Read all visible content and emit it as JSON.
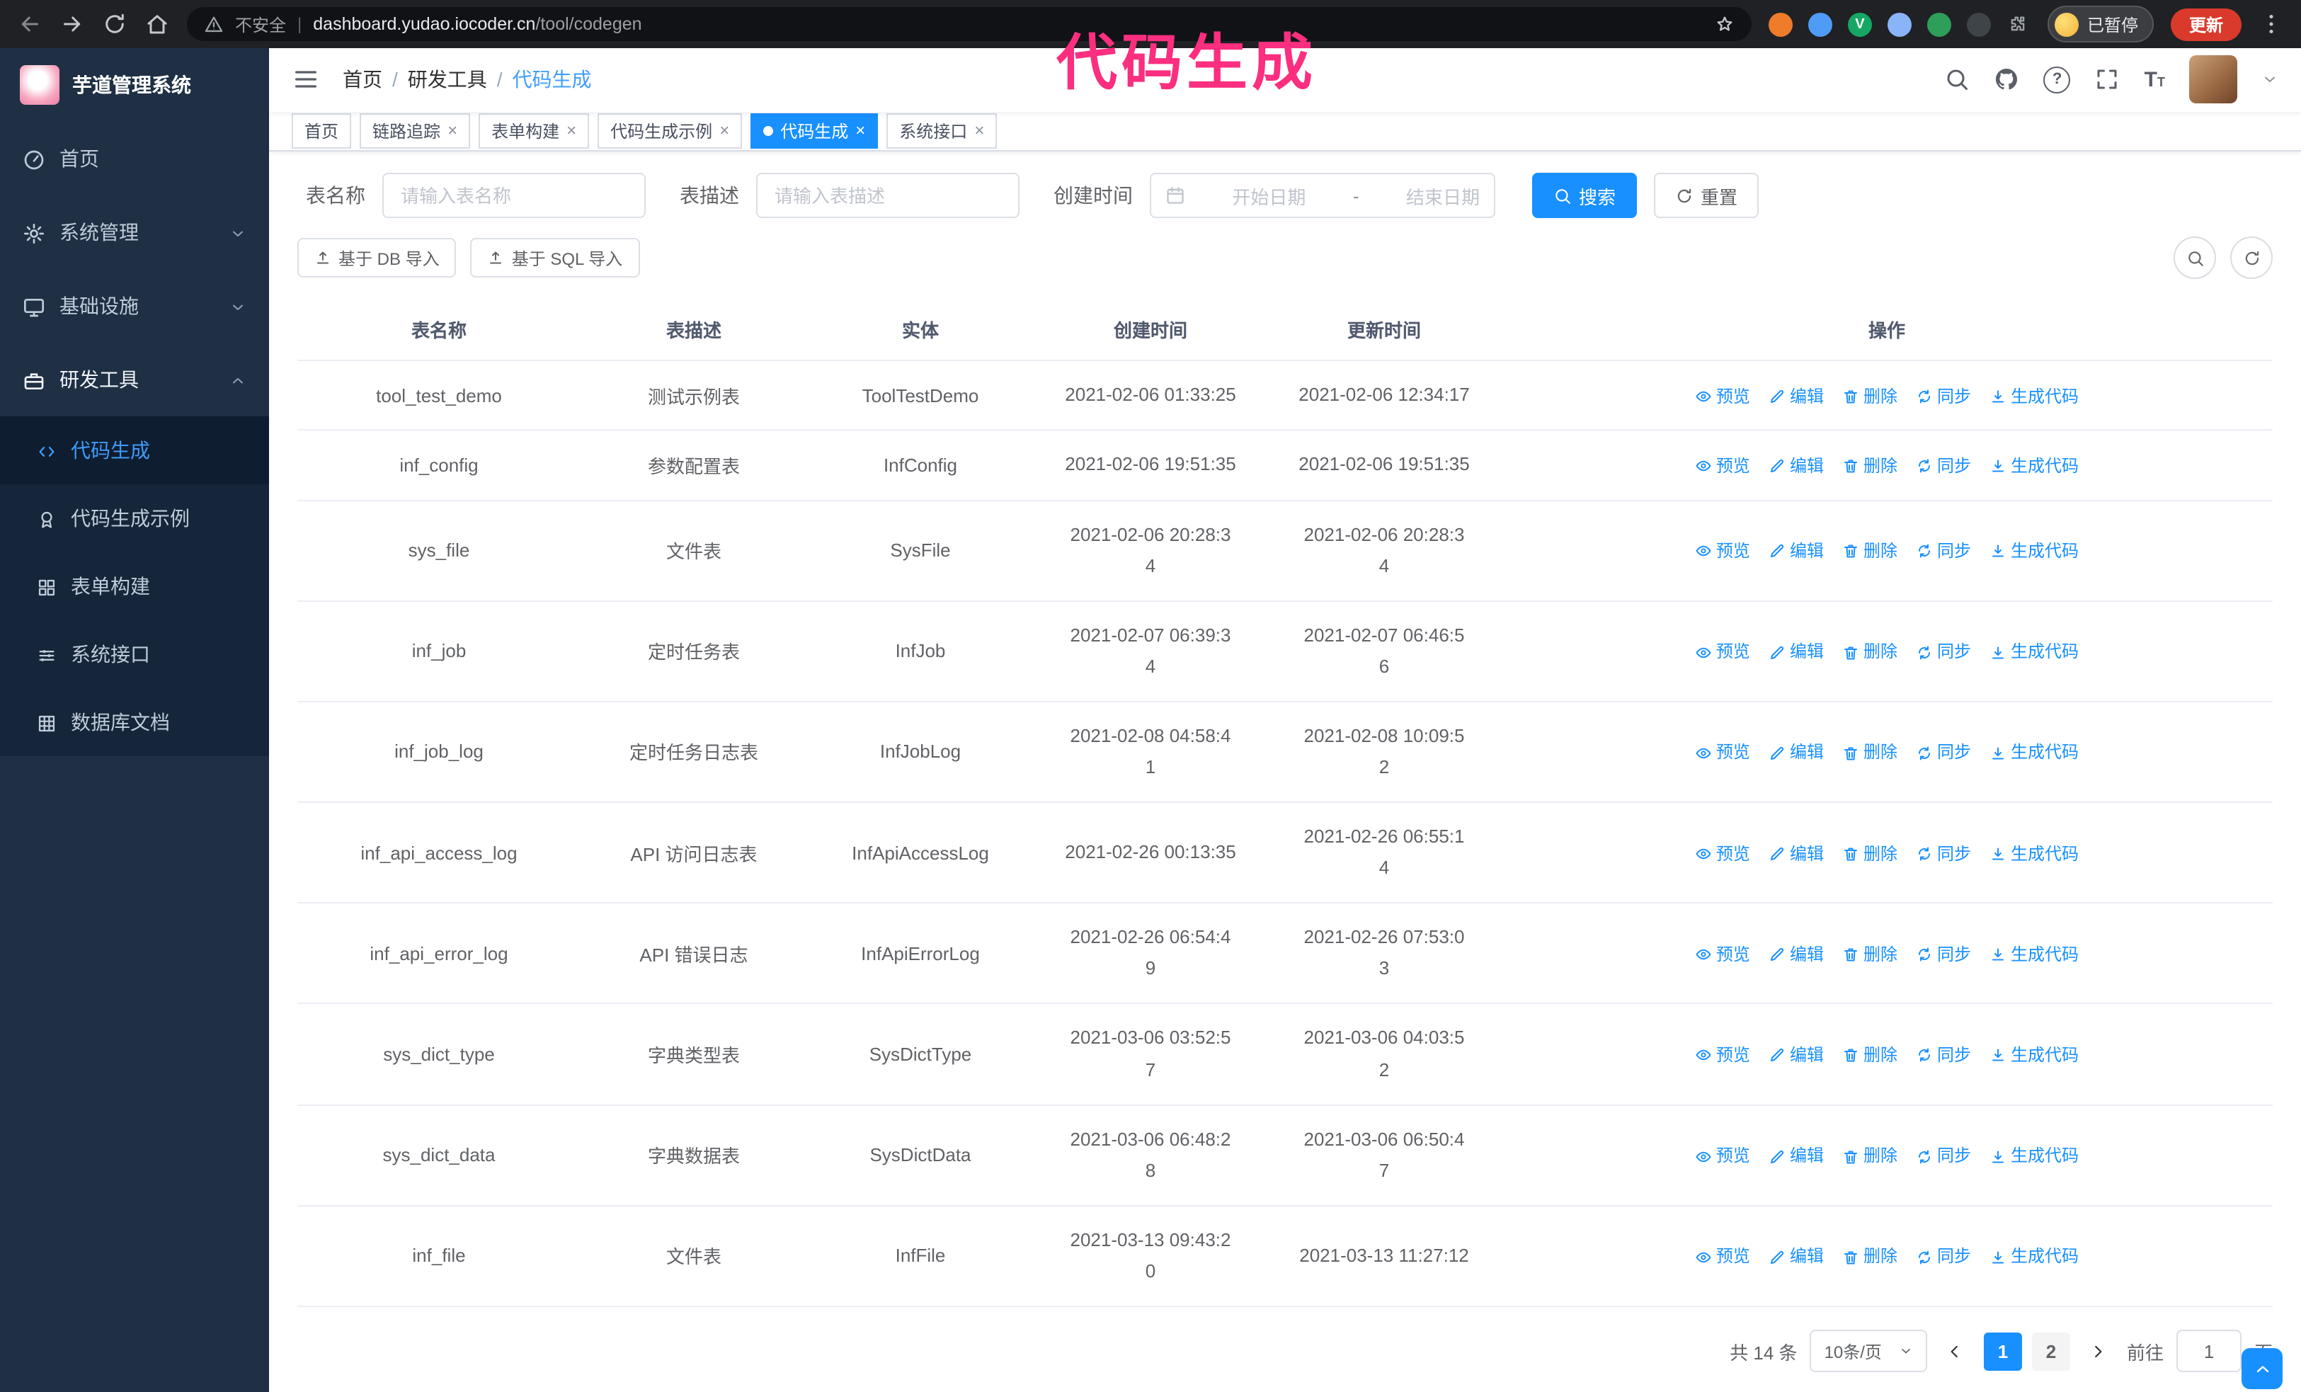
{
  "colors": {
    "accent": "#1890ff",
    "annotation": "#fb2e7f",
    "update_button": "#d93a2b",
    "sidebar_bg": "#1f3045",
    "active_link": "#3f9bfa"
  },
  "browser": {
    "security_label": "不安全",
    "url_domain": "dashboard.yudao.iocoder.cn",
    "url_path": "/tool/codegen",
    "profile_badge": "已暂停",
    "update_button": "更新",
    "extensions": [
      {
        "color": "#ee7c2b",
        "glyph": ""
      },
      {
        "color": "#4f9cf7",
        "glyph": ""
      },
      {
        "color": "#16a765",
        "glyph": "V"
      },
      {
        "color": "#8ab4f8",
        "glyph": ""
      },
      {
        "color": "#2e9e5b",
        "glyph": ""
      },
      {
        "color": "#3f4448",
        "glyph": ""
      },
      {
        "color": "#9aa0a6",
        "glyph": "",
        "icon": "puzzle"
      }
    ]
  },
  "annotation": {
    "text": "代码生成"
  },
  "sidebar": {
    "logo_title": "芋道管理系统",
    "items": [
      {
        "label": "首页",
        "icon": "gauge"
      },
      {
        "label": "系统管理",
        "icon": "gear",
        "expandable": true
      },
      {
        "label": "基础设施",
        "icon": "monitor",
        "expandable": true
      },
      {
        "label": "研发工具",
        "icon": "tools",
        "expandable": true,
        "expanded": true,
        "children": [
          {
            "label": "代码生成",
            "icon": "code",
            "active": true
          },
          {
            "label": "代码生成示例",
            "icon": "medal"
          },
          {
            "label": "表单构建",
            "icon": "form"
          },
          {
            "label": "系统接口",
            "icon": "api"
          },
          {
            "label": "数据库文档",
            "icon": "db"
          }
        ]
      }
    ]
  },
  "header": {
    "breadcrumb": [
      "首页",
      "研发工具",
      "代码生成"
    ],
    "separator": "/"
  },
  "tabs": [
    {
      "label": "首页",
      "closable": false
    },
    {
      "label": "链路追踪",
      "closable": true
    },
    {
      "label": "表单构建",
      "closable": true
    },
    {
      "label": "代码生成示例",
      "closable": true
    },
    {
      "label": "代码生成",
      "closable": true,
      "active": true
    },
    {
      "label": "系统接口",
      "closable": true
    }
  ],
  "filters": {
    "table_name_label": "表名称",
    "table_name_placeholder": "请输入表名称",
    "table_desc_label": "表描述",
    "table_desc_placeholder": "请输入表描述",
    "create_time_label": "创建时间",
    "date_start_placeholder": "开始日期",
    "date_separator": "-",
    "date_end_placeholder": "结束日期",
    "search_button": "搜索",
    "reset_button": "重置"
  },
  "toolbar": {
    "import_db_button": "基于 DB 导入",
    "import_sql_button": "基于 SQL 导入"
  },
  "table": {
    "columns": [
      "表名称",
      "表描述",
      "实体",
      "创建时间",
      "更新时间",
      "操作"
    ],
    "actions": [
      {
        "label": "预览",
        "icon": "eye",
        "name": "preview"
      },
      {
        "label": "编辑",
        "icon": "edit",
        "name": "edit"
      },
      {
        "label": "删除",
        "icon": "trash",
        "name": "delete"
      },
      {
        "label": "同步",
        "icon": "sync",
        "name": "sync"
      },
      {
        "label": "生成代码",
        "icon": "download",
        "name": "generate-code"
      }
    ],
    "rows": [
      {
        "name": "tool_test_demo",
        "desc": "测试示例表",
        "entity": "ToolTestDemo",
        "created": "2021-02-06 01:33:25",
        "updated": "2021-02-06 12:34:17"
      },
      {
        "name": "inf_config",
        "desc": "参数配置表",
        "entity": "InfConfig",
        "created": "2021-02-06 19:51:35",
        "updated": "2021-02-06 19:51:35"
      },
      {
        "name": "sys_file",
        "desc": "文件表",
        "entity": "SysFile",
        "created": "2021-02-06 20:28:3\n4",
        "updated": "2021-02-06 20:28:3\n4"
      },
      {
        "name": "inf_job",
        "desc": "定时任务表",
        "entity": "InfJob",
        "created": "2021-02-07 06:39:3\n4",
        "updated": "2021-02-07 06:46:5\n6"
      },
      {
        "name": "inf_job_log",
        "desc": "定时任务日志表",
        "entity": "InfJobLog",
        "created": "2021-02-08 04:58:4\n1",
        "updated": "2021-02-08 10:09:5\n2"
      },
      {
        "name": "inf_api_access_log",
        "desc": "API 访问日志表",
        "entity": "InfApiAccessLog",
        "created": "2021-02-26 00:13:35",
        "updated": "2021-02-26 06:55:1\n4"
      },
      {
        "name": "inf_api_error_log",
        "desc": "API 错误日志",
        "entity": "InfApiErrorLog",
        "created": "2021-02-26 06:54:4\n9",
        "updated": "2021-02-26 07:53:0\n3"
      },
      {
        "name": "sys_dict_type",
        "desc": "字典类型表",
        "entity": "SysDictType",
        "created": "2021-03-06 03:52:5\n7",
        "updated": "2021-03-06 04:03:5\n2"
      },
      {
        "name": "sys_dict_data",
        "desc": "字典数据表",
        "entity": "SysDictData",
        "created": "2021-03-06 06:48:2\n8",
        "updated": "2021-03-06 06:50:4\n7"
      },
      {
        "name": "inf_file",
        "desc": "文件表",
        "entity": "InfFile",
        "created": "2021-03-13 09:43:2\n0",
        "updated": "2021-03-13 11:27:12"
      }
    ]
  },
  "pagination": {
    "total": "共 14 条",
    "page_size": "10条/页",
    "pages": [
      {
        "label": "1",
        "active": true
      },
      {
        "label": "2",
        "active": false
      }
    ],
    "goto_label": "前往",
    "goto_value": "1",
    "unit_label": "页"
  }
}
